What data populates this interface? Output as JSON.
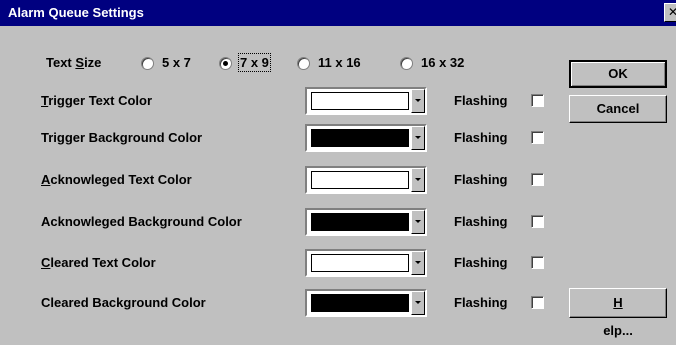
{
  "window": {
    "title": "Alarm Queue Settings",
    "close_glyph": "✕"
  },
  "text_size": {
    "label_pre": "Text ",
    "label_u": "S",
    "label_post": "ize",
    "options": [
      {
        "label": "5 x 7",
        "selected": false
      },
      {
        "label": "7 x 9",
        "selected": true
      },
      {
        "label": "11 x 16",
        "selected": false
      },
      {
        "label": "16 x 32",
        "selected": false
      }
    ]
  },
  "rows": [
    {
      "label_pre": "",
      "label_u": "T",
      "label_post": "rigger Text Color",
      "color": "#ffffff",
      "flashing_label": "Flashing",
      "flashing": false
    },
    {
      "label_pre": "Trigger Background Color",
      "label_u": "",
      "label_post": "",
      "color": "#000000",
      "flashing_label": "Flashing",
      "flashing": false
    },
    {
      "label_pre": "",
      "label_u": "A",
      "label_post": "cknowleged Text Color",
      "color": "#ffffff",
      "flashing_label": "Flashing",
      "flashing": false
    },
    {
      "label_pre": "Acknowleged Background Color",
      "label_u": "",
      "label_post": "",
      "color": "#000000",
      "flashing_label": "Flashing",
      "flashing": false
    },
    {
      "label_pre": "",
      "label_u": "C",
      "label_post": "leared Text Color",
      "color": "#ffffff",
      "flashing_label": "Flashing",
      "flashing": false
    },
    {
      "label_pre": "Cleared Background Color",
      "label_u": "",
      "label_post": "",
      "color": "#000000",
      "flashing_label": "Flashing",
      "flashing": false
    }
  ],
  "buttons": {
    "ok": "OK",
    "cancel": "Cancel",
    "help_u": "H",
    "help_post": "elp..."
  },
  "colors": {
    "titlebar": "#000080",
    "face": "#c0c0c0"
  }
}
